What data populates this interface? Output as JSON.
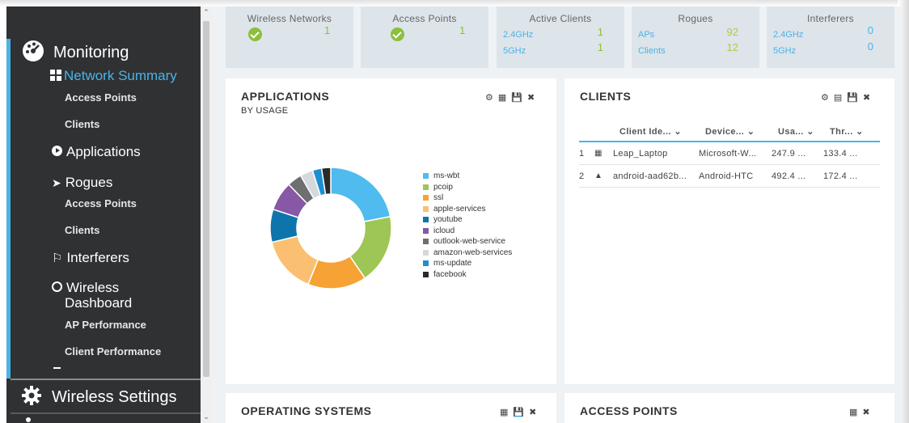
{
  "sidebar": {
    "monitoring": "Monitoring",
    "network_summary": "Network Summary",
    "access_points": "Access Points",
    "clients": "Clients",
    "applications": "Applications",
    "rogues": "Rogues",
    "rogues_access_points": "Access Points",
    "rogues_clients": "Clients",
    "interferers": "Interferers",
    "wireless": "Wireless",
    "dashboard": "Dashboard",
    "ap_performance": "AP Performance",
    "client_performance": "Client Performance",
    "wireless_settings": "Wireless Settings"
  },
  "stats": {
    "wireless_networks": {
      "title": "Wireless Networks",
      "value": "1"
    },
    "access_points": {
      "title": "Access Points",
      "value": "1"
    },
    "active_clients": {
      "title": "Active Clients",
      "row1_label": "2.4GHz",
      "row1_value": "1",
      "row2_label": "5GHz",
      "row2_value": "1"
    },
    "rogues": {
      "title": "Rogues",
      "row1_label": "APs",
      "row1_value": "92",
      "row2_label": "Clients",
      "row2_value": "12"
    },
    "interferers": {
      "title": "Interferers",
      "row1_label": "2.4GHz",
      "row1_value": "0",
      "row2_label": "5GHz",
      "row2_value": "0"
    }
  },
  "applications": {
    "title": "APPLICATIONS",
    "subtitle": "BY USAGE"
  },
  "clients_card": {
    "title": "CLIENTS",
    "columns": [
      "Client Ide...",
      "Device...",
      "Usa...",
      "Thr..."
    ],
    "rows": [
      {
        "index": "1",
        "client": "Leap_Laptop",
        "device": "Microsoft-W...",
        "usage": "247.9 ...",
        "throughput": "133.4 ..."
      },
      {
        "index": "2",
        "client": "android-aad62b...",
        "device": "Android-HTC",
        "usage": "492.4 ...",
        "throughput": "172.4 ..."
      }
    ]
  },
  "operating_systems": {
    "title": "OPERATING SYSTEMS"
  },
  "access_points_card": {
    "title": "ACCESS POINTS"
  },
  "colors": {
    "accent": "#4ab3e6",
    "sidebar_bg": "#2f3133",
    "green": "#8bbf3c",
    "yellow_green": "#b6c93a"
  },
  "chart_data": {
    "type": "pie",
    "categories": [
      "ms-wbt",
      "pcoip",
      "ssl",
      "apple-services",
      "youtube",
      "icloud",
      "outlook-web-service",
      "amazon-web-services",
      "ms-update",
      "facebook"
    ],
    "values": [
      22.5,
      19,
      16,
      15.5,
      9,
      8,
      4,
      3.5,
      2.5,
      2.5
    ],
    "colors": [
      "#4fbbee",
      "#9ec654",
      "#f6a234",
      "#fbbf72",
      "#0e75ac",
      "#8658a6",
      "#6d6f71",
      "#d5d9dd",
      "#1b8fd3",
      "#2a2a2a"
    ],
    "donut": true,
    "legend": "right"
  }
}
